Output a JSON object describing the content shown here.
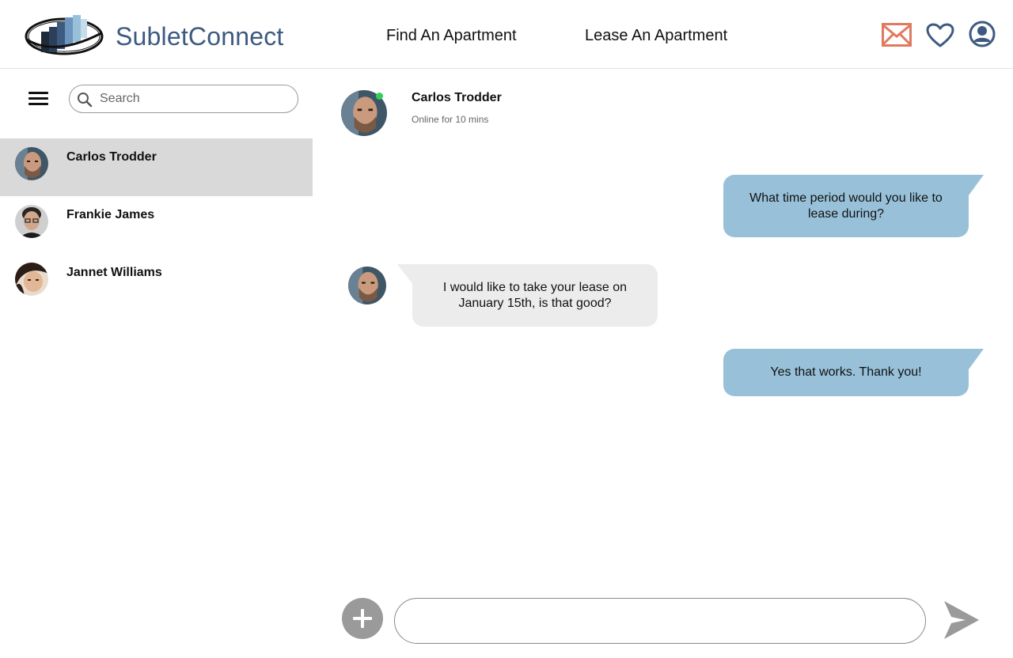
{
  "header": {
    "brand": "SubletConnect",
    "nav": {
      "find": "Find An Apartment",
      "lease": "Lease An Apartment"
    },
    "icons": [
      "mail-icon",
      "heart-icon",
      "user-icon"
    ],
    "accent_color": "#3d5a80",
    "mail_color": "#e07a5f"
  },
  "sidebar": {
    "search_placeholder": "Search",
    "contacts": [
      {
        "name": "Carlos Trodder",
        "active": true
      },
      {
        "name": "Frankie James",
        "active": false
      },
      {
        "name": "Jannet Williams",
        "active": false
      }
    ]
  },
  "chat": {
    "name": "Carlos Trodder",
    "status": "Online for 10 mins",
    "messages": [
      {
        "direction": "outgoing",
        "text": "What time period would you like to lease during?"
      },
      {
        "direction": "incoming",
        "text": "I would like to take your lease on January 15th, is that good?"
      },
      {
        "direction": "outgoing",
        "text": "Yes that works. Thank you!"
      }
    ],
    "colors": {
      "outgoing": "#98c1d9",
      "incoming": "#ececec"
    }
  },
  "composer": {
    "placeholder": ""
  }
}
